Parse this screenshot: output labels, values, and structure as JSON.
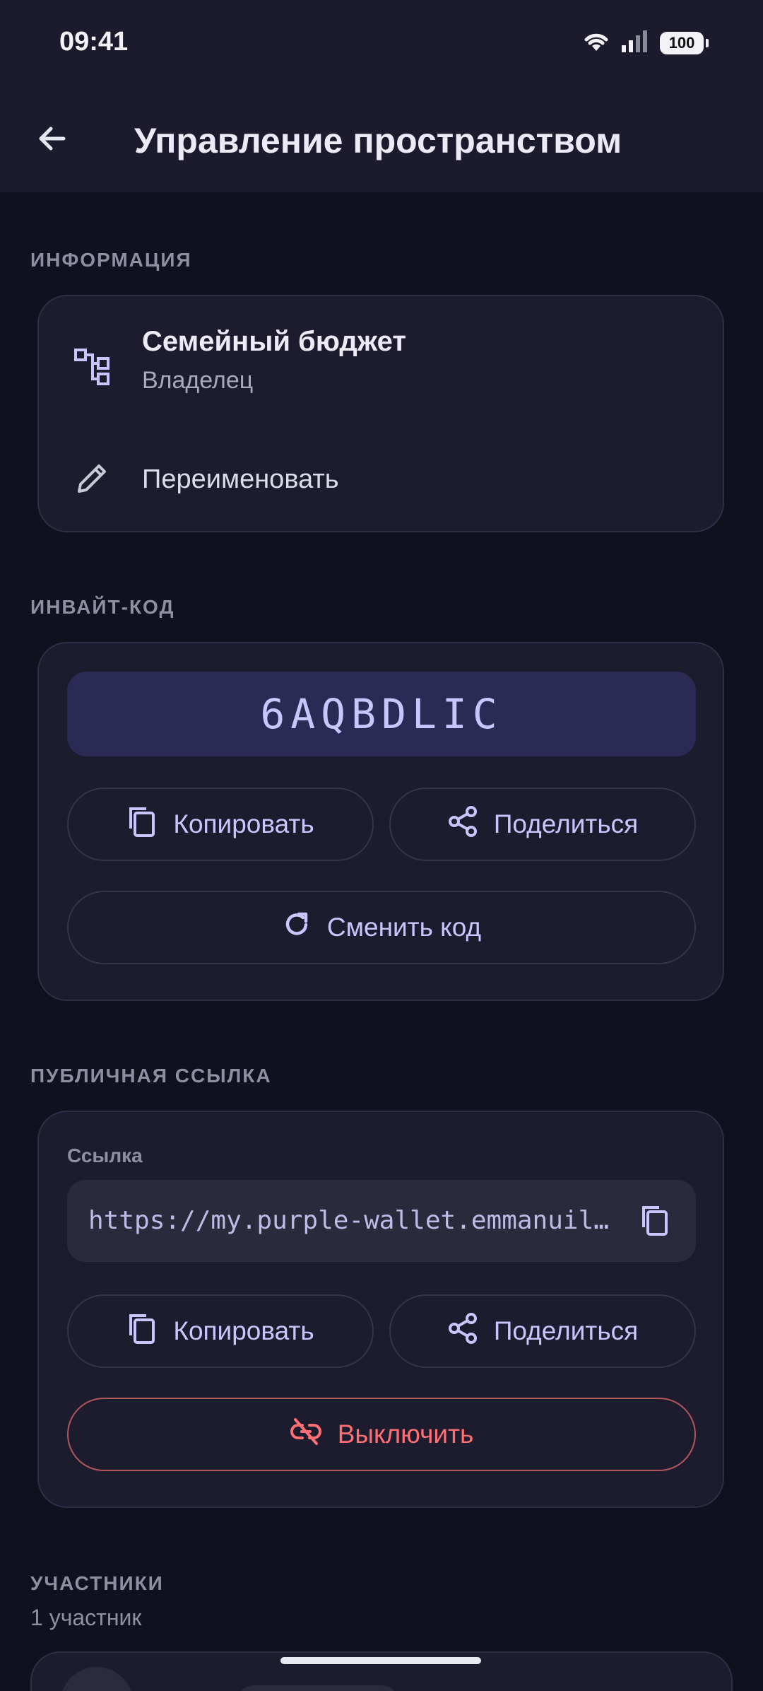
{
  "status_bar": {
    "time": "09:41",
    "battery": "100"
  },
  "app_bar": {
    "title": "Управление пространством",
    "back_icon": "arrow-left-icon"
  },
  "info_section": {
    "label": "ИНФОРМАЦИЯ",
    "space_name": "Семейный бюджет",
    "role": "Владелец",
    "rename_label": "Переименовать"
  },
  "invite_section": {
    "label": "ИНВАЙТ-КОД",
    "code": "6AQBDLIC",
    "copy_label": "Копировать",
    "share_label": "Поделиться",
    "regenerate_label": "Сменить код"
  },
  "public_link_section": {
    "label": "ПУБЛИЧНАЯ ССЫЛКА",
    "field_label": "Ссылка",
    "url": "https://my.purple-wallet.emmanuil…",
    "copy_label": "Копировать",
    "share_label": "Поделиться",
    "disable_label": "Выключить"
  },
  "members_section": {
    "label": "УЧАСТНИКИ",
    "count_text": "1 участник"
  },
  "colors": {
    "accent": "#c9c6ff",
    "danger": "#ff6f73",
    "background": "#10101f",
    "card": "#1c1c2e"
  }
}
